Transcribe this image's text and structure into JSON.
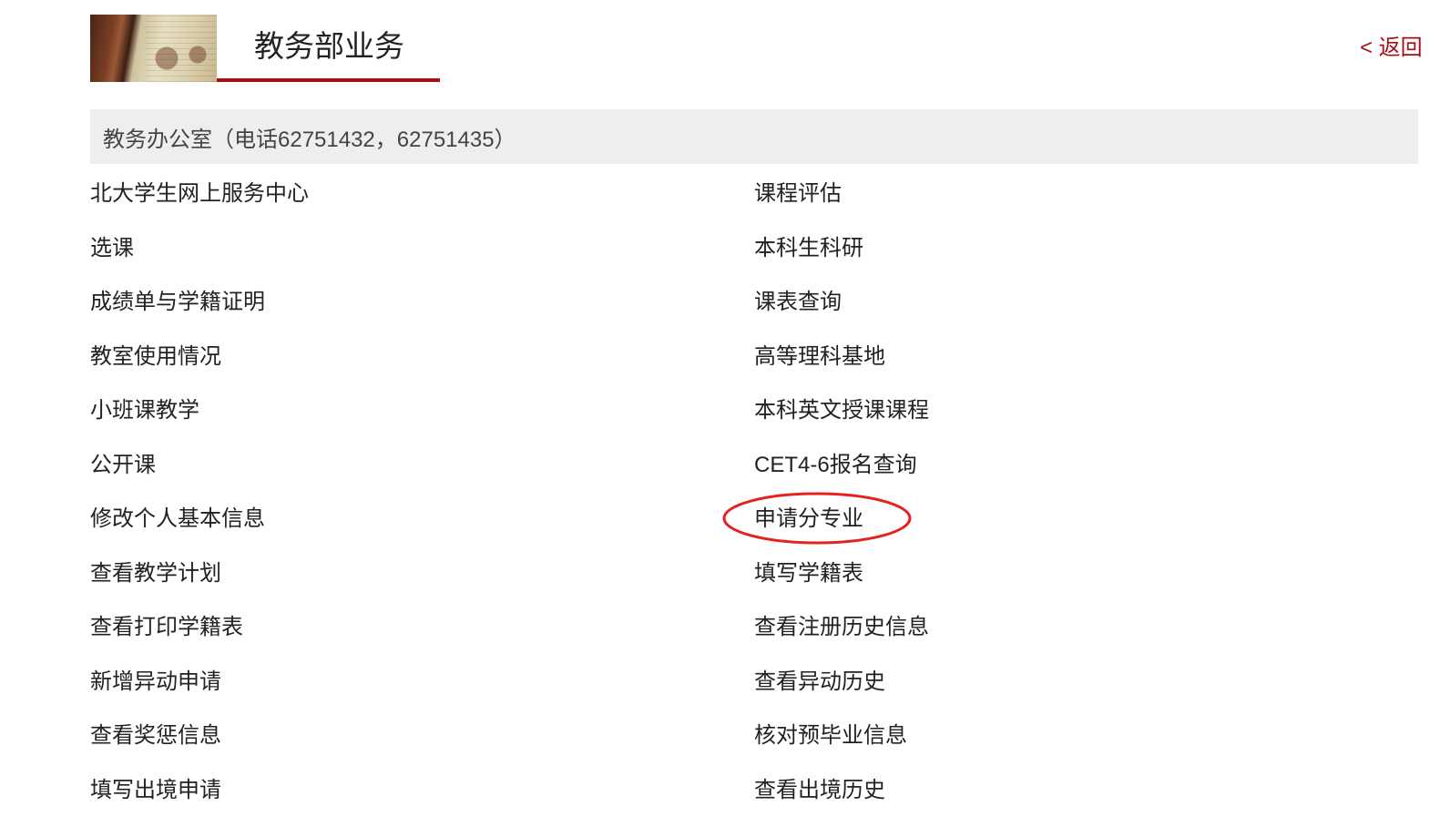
{
  "header": {
    "title": "教务部业务",
    "back_label": "< 返回"
  },
  "office": {
    "label": "教务办公室（电话62751432，62751435）"
  },
  "links": {
    "left": [
      "北大学生网上服务中心",
      "选课",
      "成绩单与学籍证明",
      "教室使用情况",
      "小班课教学",
      "公开课",
      "修改个人基本信息",
      "查看教学计划",
      "查看打印学籍表",
      "新增异动申请",
      "查看奖惩信息",
      "填写出境申请"
    ],
    "right": [
      "课程评估",
      "本科生科研",
      "课表查询",
      "高等理科基地",
      "本科英文授课课程",
      "CET4-6报名查询",
      "申请分专业",
      "填写学籍表",
      "查看注册历史信息",
      "查看异动历史",
      "核对预毕业信息",
      "查看出境历史"
    ]
  },
  "annotation": {
    "highlighted_item": "申请分专业",
    "shape": "ellipse"
  },
  "colors": {
    "accent": "#a50f14",
    "office_bar_bg": "#eeeeee",
    "annotation_stroke": "#e5221f",
    "text": "#222222"
  }
}
